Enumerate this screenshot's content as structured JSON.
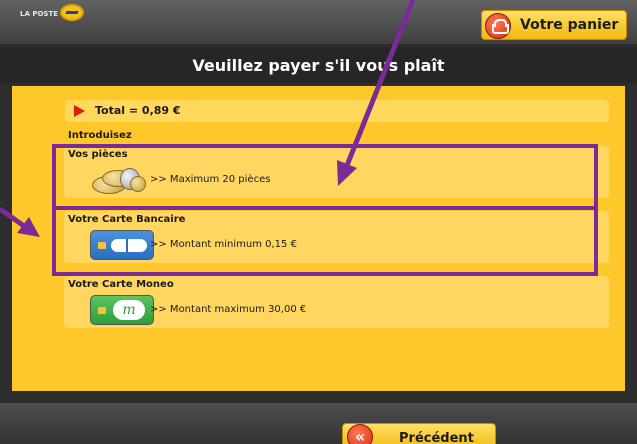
{
  "header": {
    "logo_text": "LA POSTE",
    "cart_label": "Votre panier",
    "cart_icon": "basket-icon"
  },
  "title": "Veuillez payer s'il vous plaît",
  "total": {
    "label": "Total = 0,89 €"
  },
  "intro": "Introduisez",
  "options": [
    {
      "title": "Vos pièces",
      "desc": ">> Maximum 20 pièces",
      "icon": "coins-icon"
    },
    {
      "title": "Votre Carte Bancaire",
      "desc": ">> Montant minimum 0,15 €",
      "icon": "cb-card-icon"
    },
    {
      "title": "Votre Carte Moneo",
      "desc": ">> Montant maximum 30,00 €",
      "icon": "moneo-card-icon"
    }
  ],
  "moneo_logo_text": "m",
  "footer": {
    "back_label": "Précédent",
    "back_icon": "double-chevron-left-icon"
  },
  "colors": {
    "panel_yellow": "#ffc82a",
    "highlight": "#7a2b96",
    "accent_red": "#d72e12"
  }
}
